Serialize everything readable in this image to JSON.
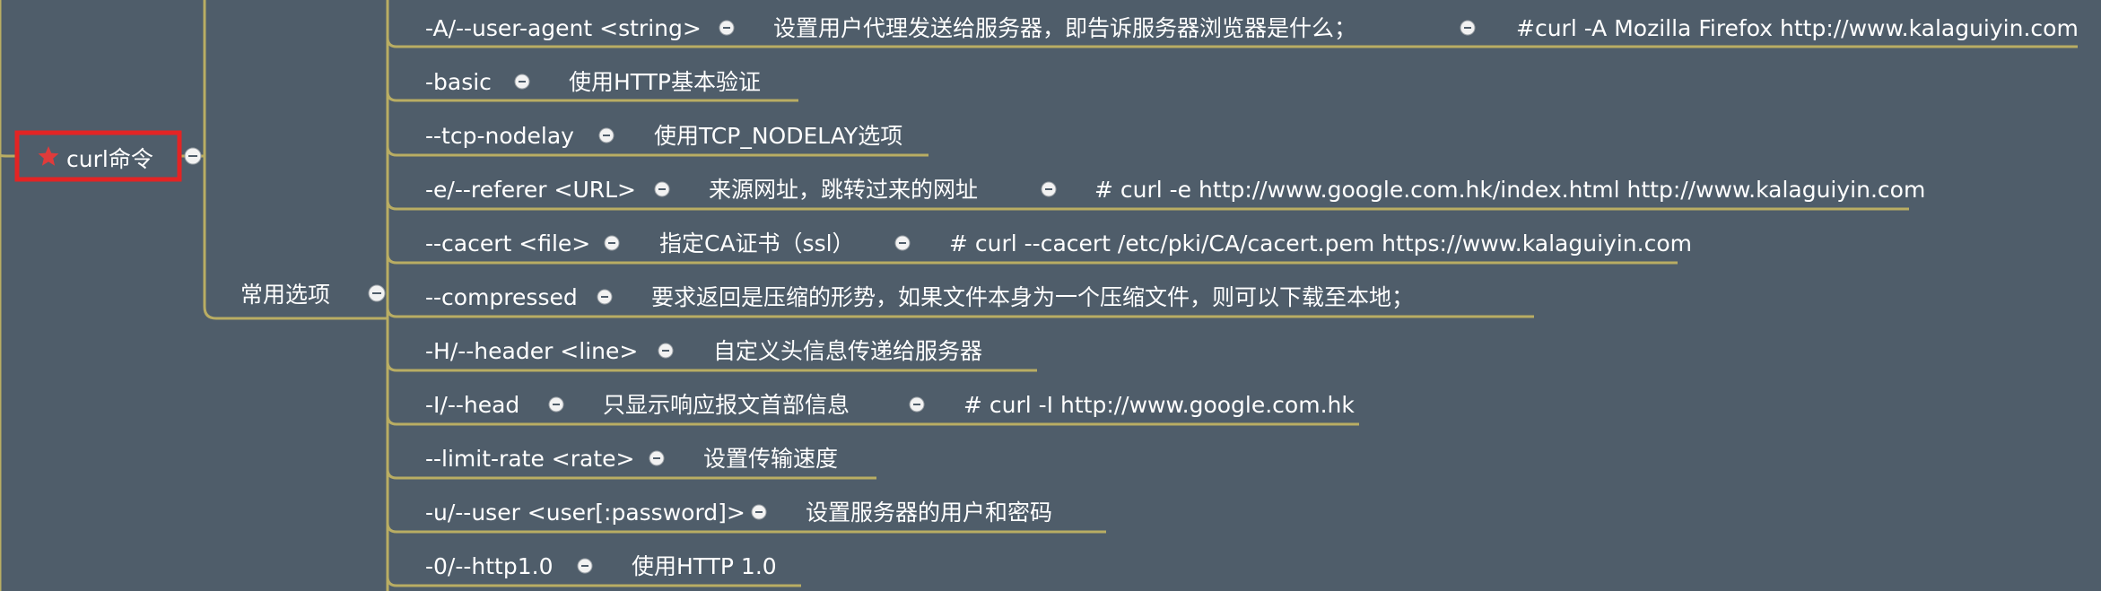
{
  "mindmap": {
    "root": {
      "label": "curl命令",
      "icon": "star-icon",
      "icon_color": "#e03b3b",
      "highlight_color": "#e32424"
    },
    "branch": {
      "label": "常用选项"
    },
    "options": [
      {
        "option": "-A/--user-agent <string>",
        "desc": "设置用户代理发送给服务器，即告诉服务器浏览器是什么；",
        "example": "#curl -A Mozilla Firefox http://www.kalaguiyin.com"
      },
      {
        "option": "-basic",
        "desc": "使用HTTP基本验证"
      },
      {
        "option": "--tcp-nodelay",
        "desc": "使用TCP_NODELAY选项"
      },
      {
        "option": "-e/--referer <URL>",
        "desc": "来源网址，跳转过来的网址",
        "example": "# curl -e http://www.google.com.hk/index.html http://www.kalaguiyin.com"
      },
      {
        "option": "--cacert <file>",
        "desc": "指定CA证书（ssl）",
        "example": "# curl --cacert /etc/pki/CA/cacert.pem https://www.kalaguiyin.com"
      },
      {
        "option": "--compressed",
        "desc": "要求返回是压缩的形势，如果文件本身为一个压缩文件，则可以下载至本地；"
      },
      {
        "option": "-H/--header <line>",
        "desc": "自定义头信息传递给服务器"
      },
      {
        "option": "-I/--head",
        "desc": "只显示响应报文首部信息",
        "example": "# curl -I http://www.google.com.hk"
      },
      {
        "option": "--limit-rate <rate>",
        "desc": "设置传输速度"
      },
      {
        "option": "-u/--user <user[:password]>",
        "desc": "设置服务器的用户和密码"
      },
      {
        "option": "-0/--http1.0",
        "desc": "使用HTTP 1.0"
      }
    ],
    "colors": {
      "background": "#4f5d6a",
      "connector": "#b9ad63",
      "text": "#ffffff",
      "toggle": "#f2f2f2"
    }
  }
}
